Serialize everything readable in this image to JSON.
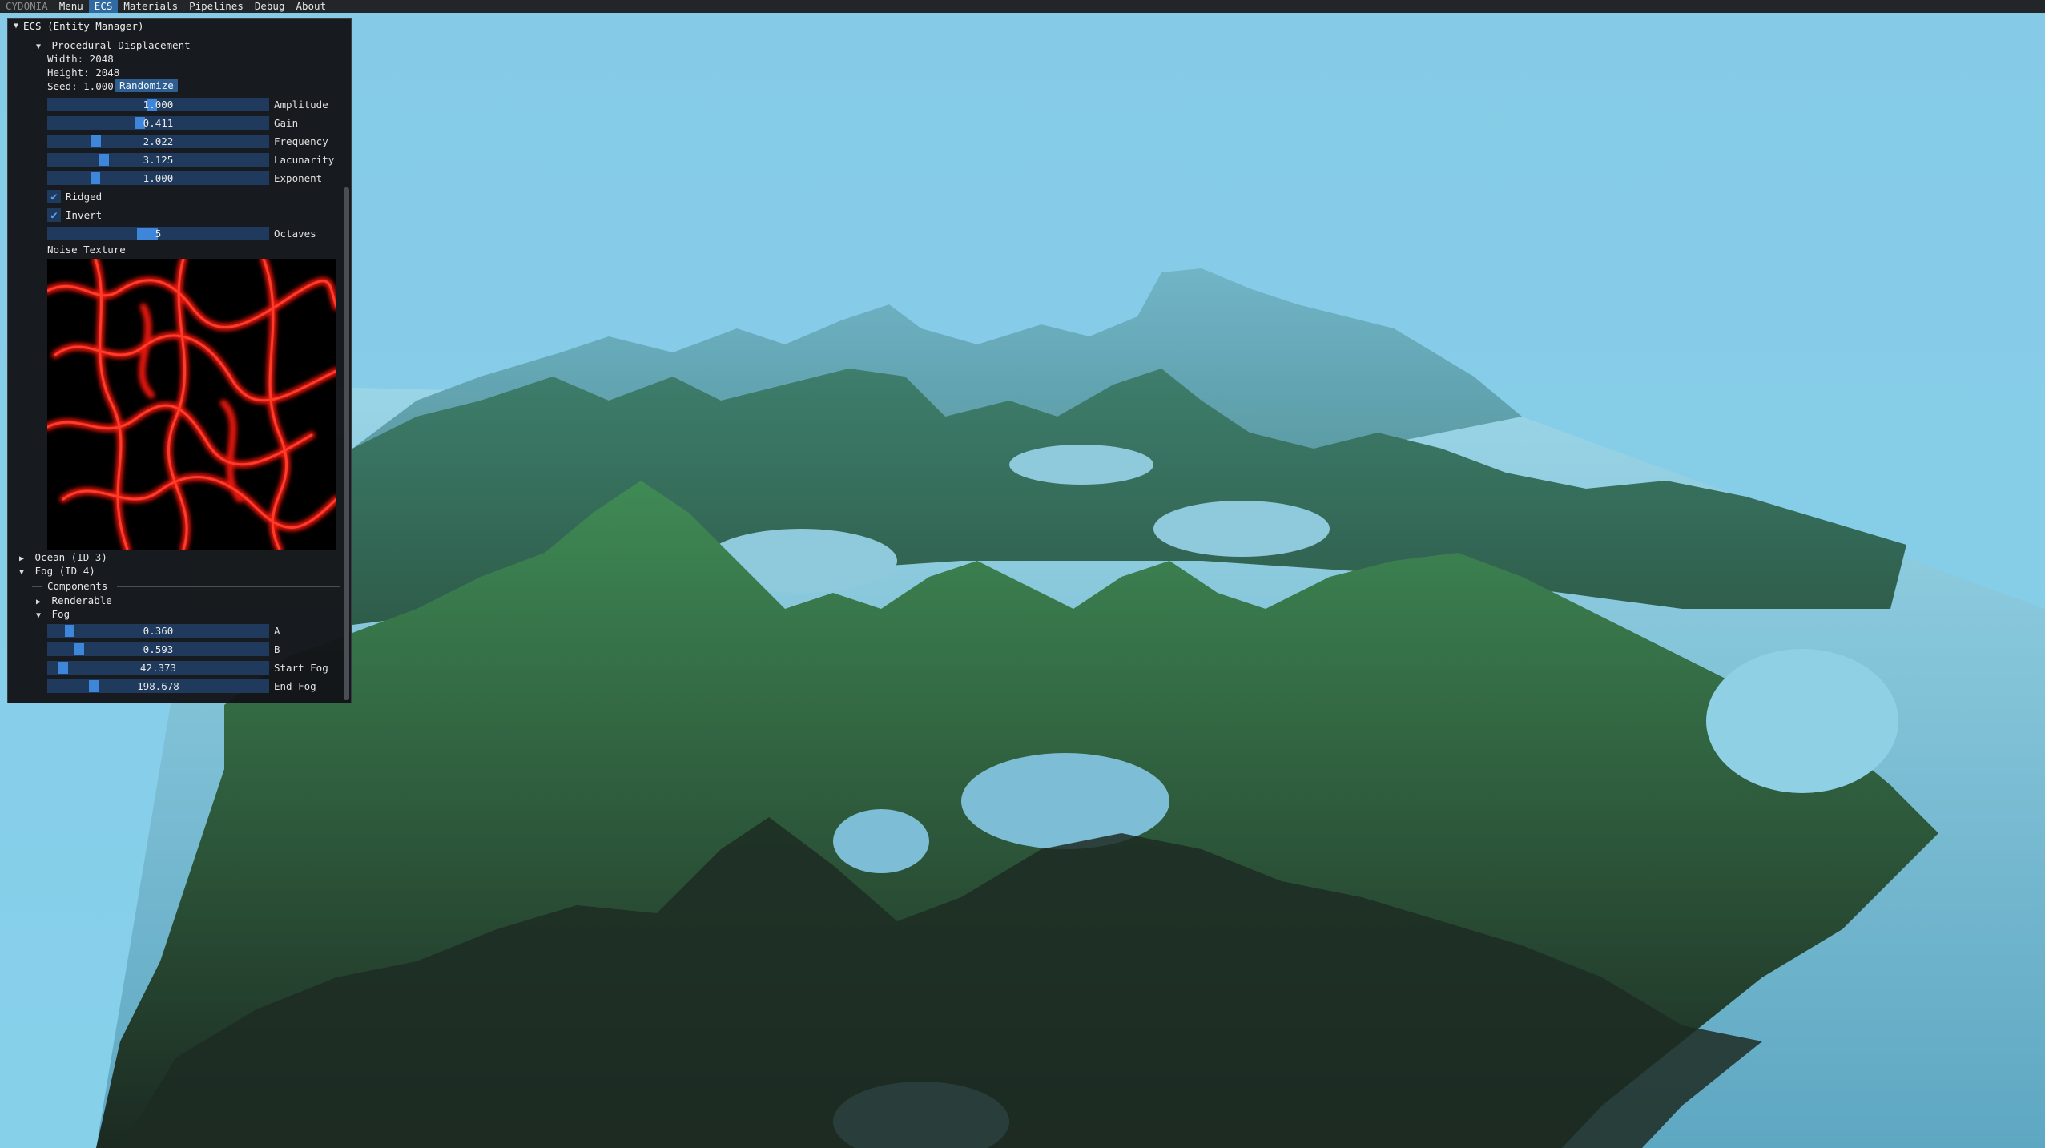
{
  "menubar": {
    "items": [
      "CYDONIA",
      "Menu",
      "ECS",
      "Materials",
      "Pipelines",
      "Debug",
      "About"
    ],
    "active": "ECS"
  },
  "panel": {
    "title": "ECS (Entity Manager)",
    "procedural": {
      "header": "Procedural Displacement",
      "width_text": "Width: 2048",
      "height_text": "Height: 2048",
      "seed_text": "Seed: 1.000",
      "randomize_label": "Randomize",
      "sliders": [
        {
          "label": "Amplitude",
          "value": "1.000"
        },
        {
          "label": "Gain",
          "value": "0.411"
        },
        {
          "label": "Frequency",
          "value": "2.022"
        },
        {
          "label": "Lacunarity",
          "value": "3.125"
        },
        {
          "label": "Exponent",
          "value": "1.000"
        }
      ],
      "checkboxes": [
        {
          "label": "Ridged",
          "checked": true
        },
        {
          "label": "Invert",
          "checked": true
        }
      ],
      "octaves": {
        "label": "Octaves",
        "value": "5"
      },
      "noise_label": "Noise Texture"
    },
    "ocean_label": "Ocean (ID 3)",
    "fog_entity_label": "Fog (ID 4)",
    "components_label": "Components",
    "renderable_label": "Renderable",
    "fog_label": "Fog",
    "fog_sliders": [
      {
        "label": "A",
        "value": "0.360"
      },
      {
        "label": "B",
        "value": "0.593"
      },
      {
        "label": "Start Fog",
        "value": "42.373"
      },
      {
        "label": "End Fog",
        "value": "198.678"
      }
    ]
  },
  "colors": {
    "sky": "#86cde8",
    "accent": "#3d86d9",
    "noise": "#ff1a10"
  }
}
